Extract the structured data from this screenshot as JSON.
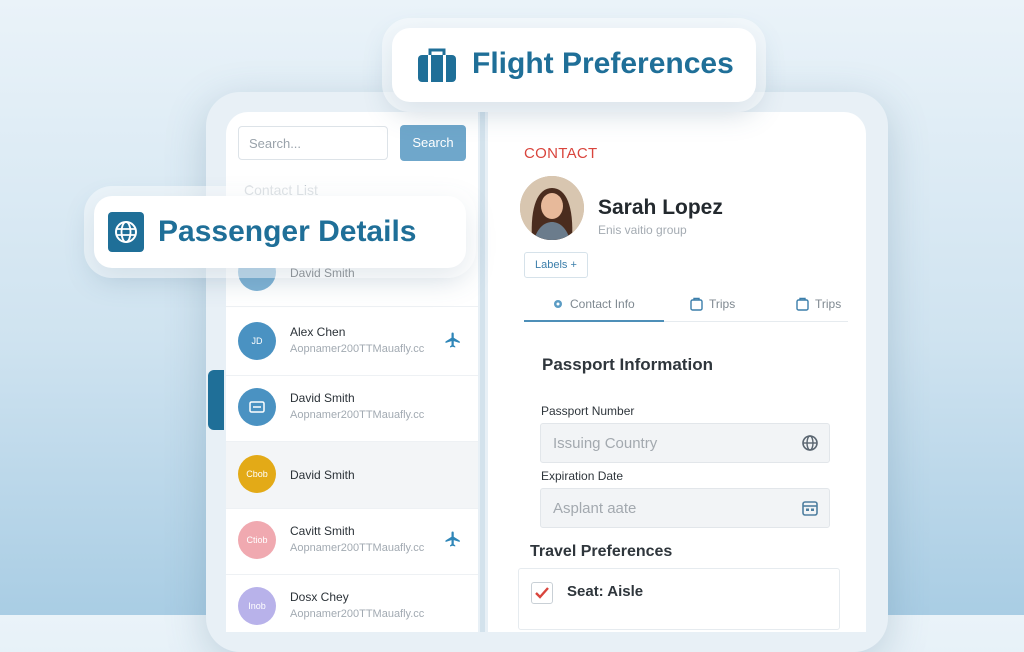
{
  "colors": {
    "accent": "#1f6f98",
    "contact_red": "#d9453d",
    "search_btn": "#6fa7cb"
  },
  "flight_badge": {
    "icon": "suitcase-icon",
    "label": "Flight Preferences"
  },
  "passenger_badge": {
    "icon": "globe-icon",
    "label": "Passenger Details"
  },
  "search": {
    "placeholder": "Search...",
    "button": "Search"
  },
  "contact_list": {
    "heading": "Contact List",
    "items": [
      {
        "name": "David Smith",
        "email": "",
        "avatar_text": "",
        "avatar_color": "#7fb3d5",
        "plane": false
      },
      {
        "name": "Alex Chen",
        "email": "Aopnamer200TTMauafly.cc",
        "avatar_text": "JD",
        "avatar_color": "#4a92c2",
        "plane": true
      },
      {
        "name": "David Smith",
        "email": "Aopnamer200TTMauafly.cc",
        "avatar_text": "",
        "avatar_color": "#4a92c2",
        "plane": false
      },
      {
        "name": "David Smith",
        "email": "",
        "avatar_text": "Cbob",
        "avatar_color": "#e3aa17",
        "plane": false
      },
      {
        "name": "Cavitt Smith",
        "email": "Aopnamer200TTMauafly.cc",
        "avatar_text": "Ctiob",
        "avatar_color": "#f0a9b0",
        "plane": true
      },
      {
        "name": "Dosx Chey",
        "email": "Aopnamer200TTMauafly.cc",
        "avatar_text": "Inob",
        "avatar_color": "#b8b2ea",
        "plane": false
      }
    ]
  },
  "contact": {
    "section_label": "CONTACT",
    "name": "Sarah Lopez",
    "subtitle": "Enis vaitio group",
    "labels_button": "Labels +"
  },
  "tabs": [
    {
      "label": "Contact Info",
      "icon": "gear-icon"
    },
    {
      "label": "Trips",
      "icon": "bag-icon"
    },
    {
      "label": "Trips",
      "icon": "bag-icon"
    }
  ],
  "passport": {
    "title": "Passport Information",
    "number_label": "Passport Number",
    "number_value": "Issuing Country",
    "expiry_label": "Expiration Date",
    "expiry_value": "Asplant aate"
  },
  "travel": {
    "title": "Travel Preferences",
    "seat_label": "Seat: Aisle",
    "seat_checked": true
  }
}
